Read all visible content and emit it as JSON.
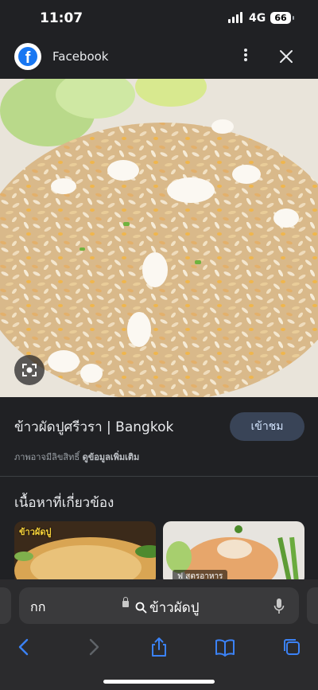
{
  "status_bar": {
    "time": "11:07",
    "network": "4G",
    "battery": "66"
  },
  "header": {
    "app_name": "Facebook",
    "logo_letter": "f"
  },
  "result": {
    "title": "ข้าวผัดปูศรีวรา | Bangkok",
    "visit_label": "เข้าชม",
    "copyright_text": "ภาพอาจมีลิขสิทธิ์",
    "more_info_link": "ดูข้อมูลเพิ่มเติม"
  },
  "related": {
    "heading": "เนื้อหาที่เกี่ยวข้อง",
    "items": [
      {
        "overlay_text": "ข้าวผัดปู"
      },
      {
        "overlay_text": "ฟู สูตรอาหาร"
      }
    ]
  },
  "browser": {
    "aa_label": "กก",
    "query": "ข้าวผัดปู"
  },
  "colors": {
    "accent": "#8ab4f8",
    "facebook_blue": "#1877f2",
    "visit_button": "#394457"
  },
  "icons": [
    "facebook-logo-icon",
    "more-vert-icon",
    "close-icon",
    "google-lens-icon",
    "lock-icon",
    "search-icon",
    "microphone-icon",
    "back-icon",
    "forward-icon",
    "share-icon",
    "bookmarks-icon",
    "tabs-icon"
  ]
}
